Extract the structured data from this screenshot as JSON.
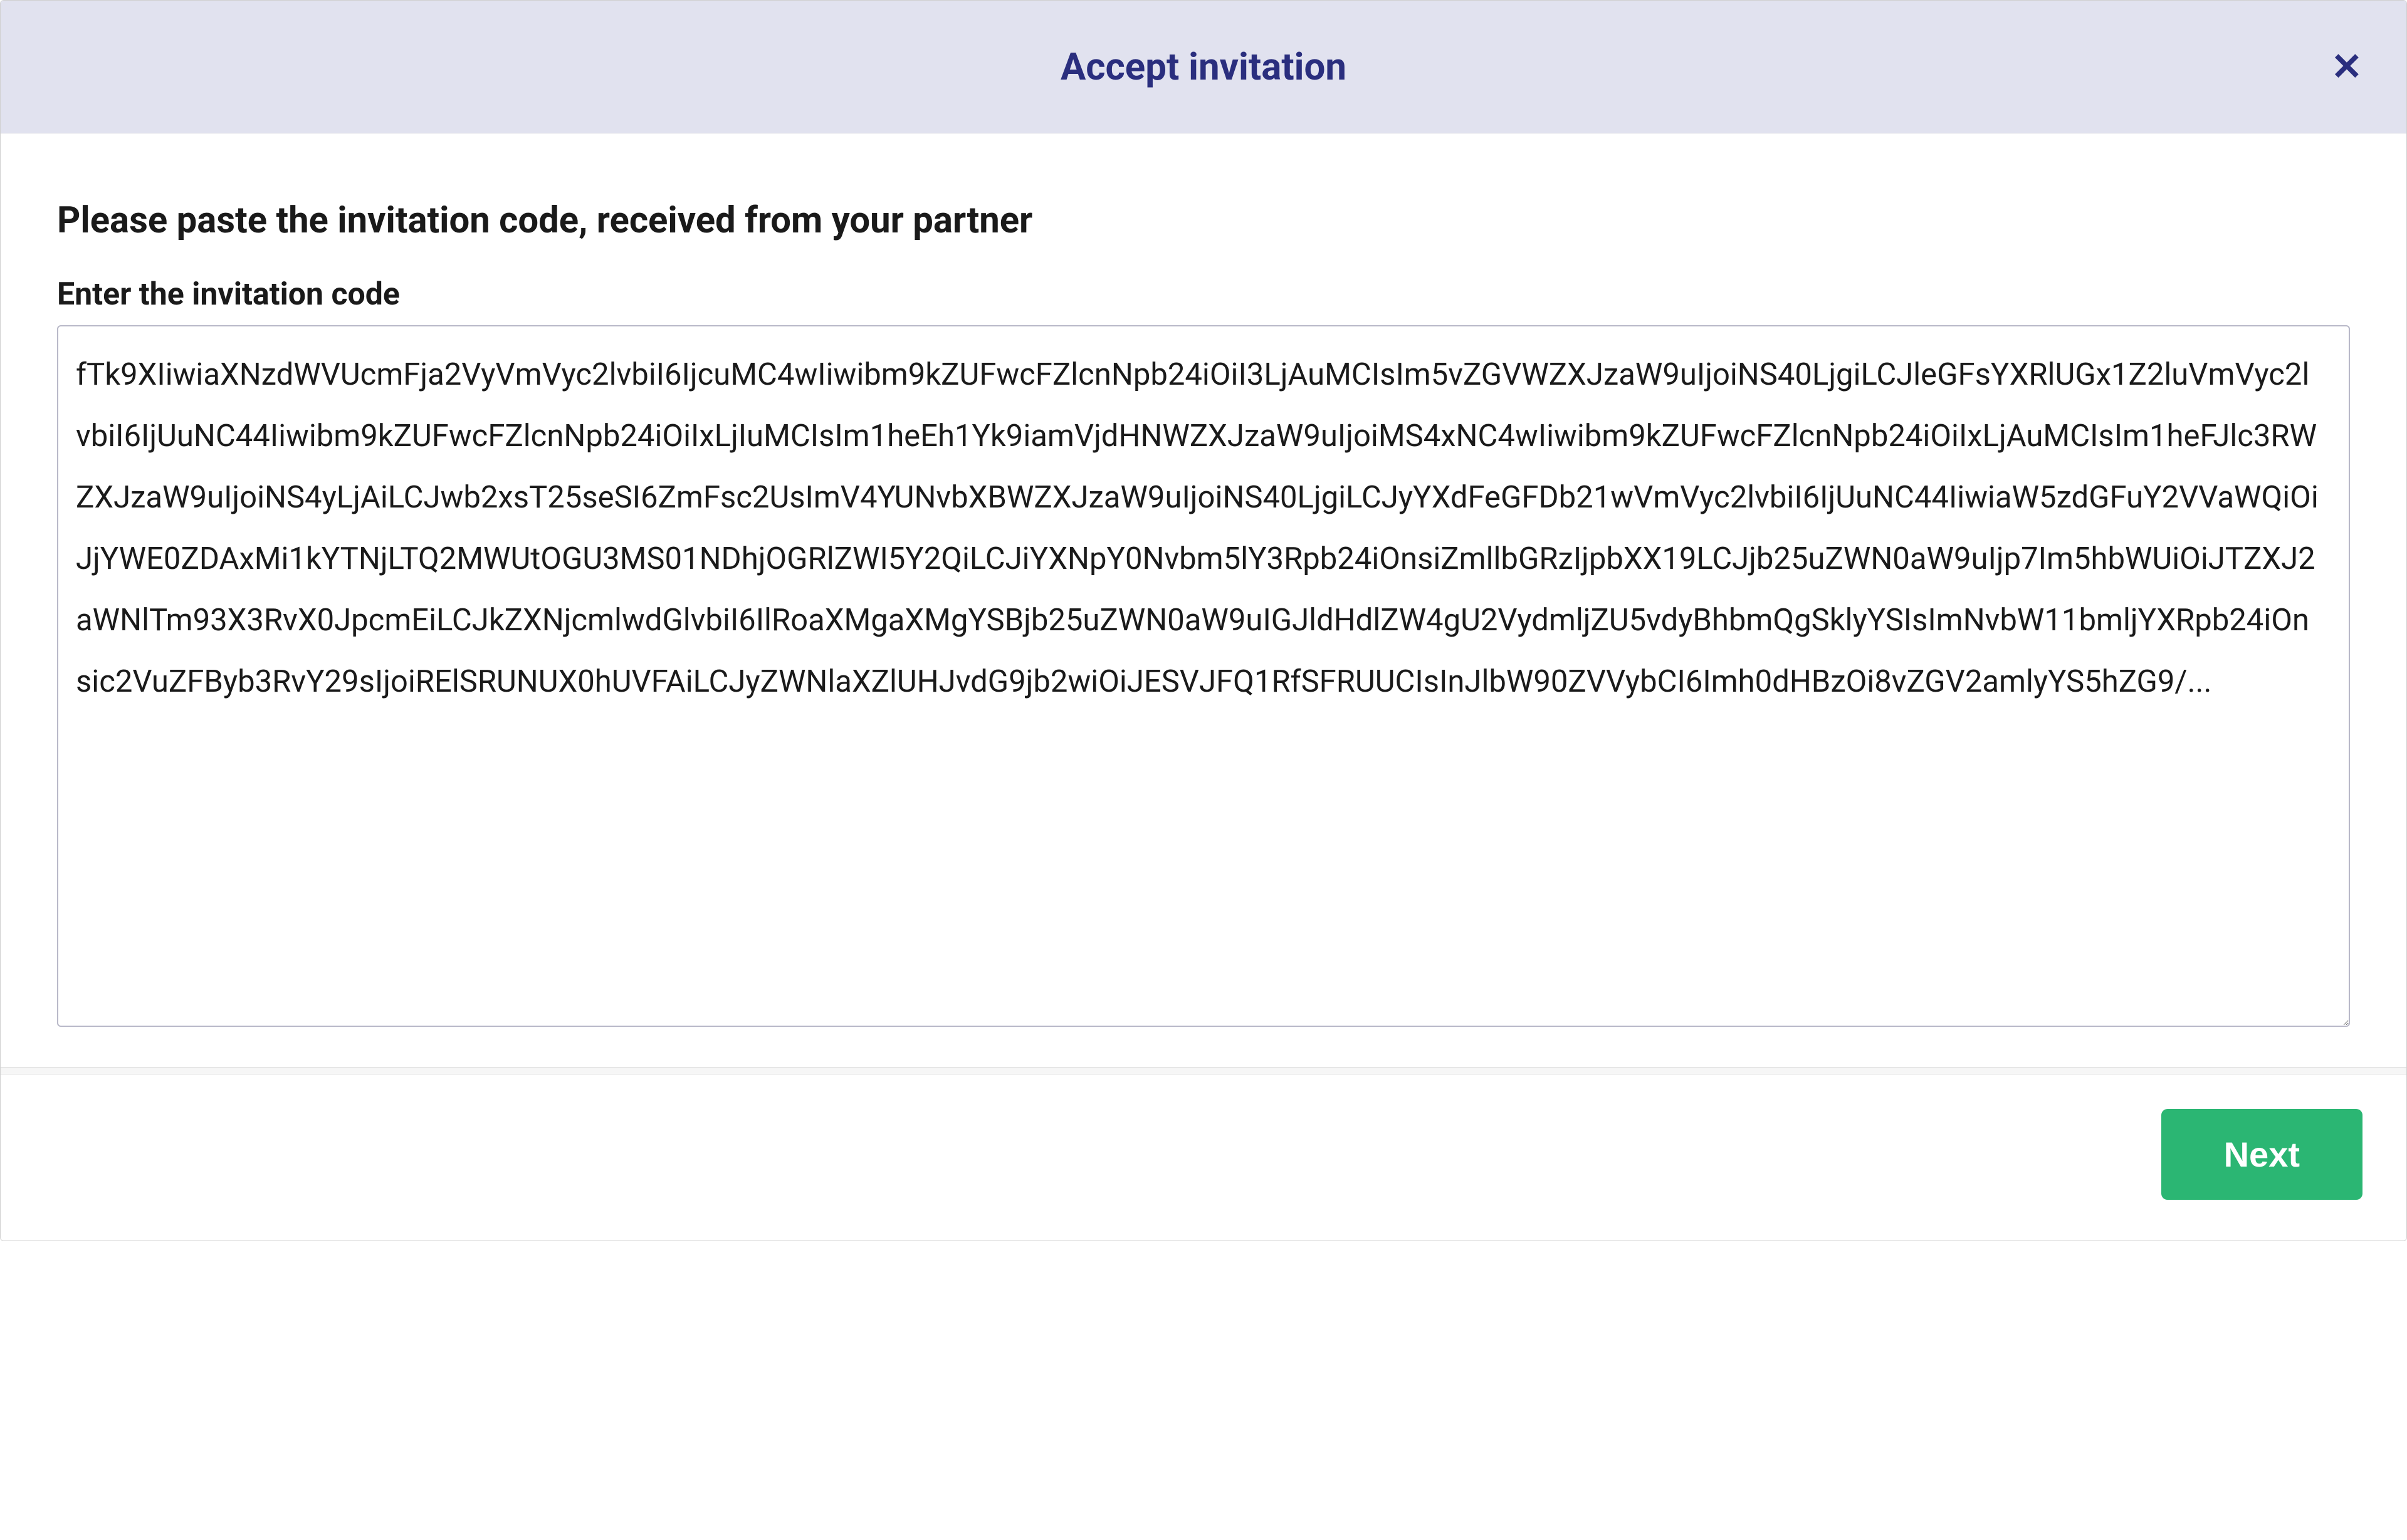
{
  "modal": {
    "title": "Accept invitation",
    "close_glyph": "✕",
    "instruction": "Please paste the invitation code, received from your partner",
    "field_label": "Enter the invitation code",
    "textarea_value": "fTk9XIiwiaXNzdWVUcmFja2VyVmVyc2lvbiI6IjcuMC4wIiwibm9kZUFwcFZlcnNpb24iOiI3LjAuMCIsIm5vZGVWZXJzaW9uIjoiNS40LjgiLCJleGFsYXRlUGx1Z2luVmVyc2lvbiI6IjUuNC44Iiwibm9kZUFwcFZlcnNpb24iOiIxLjIuMCIsIm1heEh1Yk9iamVjdHNWZXJzaW9uIjoiMS4xNC4wIiwibm9kZUFwcFZlcnNpb24iOiIxLjAuMCIsIm1heFJlc3RWZXJzaW9uIjoiNS4yLjAiLCJwb2xsT25seSI6ZmFsc2UsImV4YUNvbXBWZXJzaW9uIjoiNS40LjgiLCJyYXdFeGFDb21wVmVyc2lvbiI6IjUuNC44IiwiaW5zdGFuY2VVaWQiOiJjYWE0ZDAxMi1kYTNjLTQ2MWUtOGU3MS01NDhjOGRlZWI5Y2QiLCJiYXNpY0Nvbm5lY3Rpb24iOnsiZmllbGRzIjpbXX19LCJjb25uZWN0aW9uIjp7Im5hbWUiOiJTZXJ2aWNlTm93X3RvX0JpcmEiLCJkZXNjcmlwdGlvbiI6IlRoaXMgaXMgYSBjb25uZWN0aW9uIGJldHdlZW4gU2VydmljZU5vdyBhbmQgSklyYSIsImNvbW11bmljYXRpb24iOnsic2VuZFByb3RvY29sIjoiRElSRUNUX0hUVFAiLCJyZWNlaXZlUHJvdG9jb2wiOiJESVJFQ1RfSFRUUCIsInJlbW90ZVVybCI6Imh0dHBzOi8vZGV2amlyYS5hZG9/...",
    "next_label": "Next"
  }
}
